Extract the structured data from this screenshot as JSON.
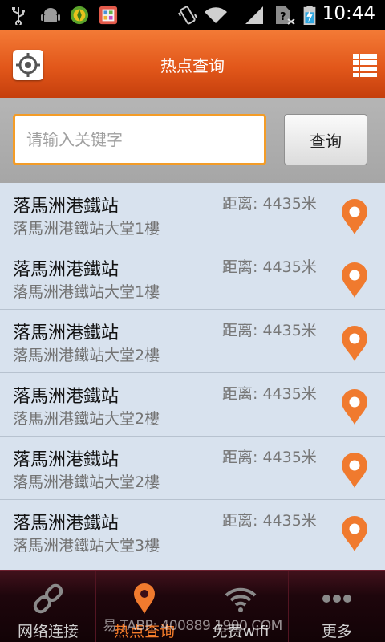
{
  "status_bar": {
    "time": "10:44",
    "icons": [
      "usb-icon",
      "android-debug-icon",
      "app-notification-icon",
      "gallery-notification-icon",
      "vibrate-icon",
      "wifi-icon",
      "signal-icon",
      "no-sim-icon",
      "battery-charging-icon"
    ]
  },
  "header": {
    "title": "热点查询",
    "left_button_icon": "locate-icon",
    "right_button_icon": "list-icon"
  },
  "search": {
    "placeholder": "请输入关键字",
    "value": "",
    "button_label": "查询"
  },
  "colors": {
    "accent": "#f37a36",
    "pin": "#f07a2e",
    "list_bg": "#d8e2ee",
    "nav_bg": "#1e060c"
  },
  "results": [
    {
      "name": "落馬洲港鐵站",
      "address": "落馬洲港鐵站大堂1樓",
      "distance": "距离: 4435米"
    },
    {
      "name": "落馬洲港鐵站",
      "address": "落馬洲港鐵站大堂1樓",
      "distance": "距离: 4435米"
    },
    {
      "name": "落馬洲港鐵站",
      "address": "落馬洲港鐵站大堂2樓",
      "distance": "距离: 4435米"
    },
    {
      "name": "落馬洲港鐵站",
      "address": "落馬洲港鐵站大堂2樓",
      "distance": "距离: 4435米"
    },
    {
      "name": "落馬洲港鐵站",
      "address": "落馬洲港鐵站大堂2樓",
      "distance": "距离: 4435米"
    },
    {
      "name": "落馬洲港鐵站",
      "address": "落馬洲港鐵站大堂3樓",
      "distance": "距离: 4435米"
    },
    {
      "name": "",
      "address": "",
      "distance": ""
    }
  ],
  "bottom_nav": {
    "tabs": [
      {
        "label": "网络连接",
        "icon": "link-icon",
        "active": false
      },
      {
        "label": "热点查询",
        "icon": "location-pin-icon",
        "active": true
      },
      {
        "label": "免费wifi",
        "icon": "wifi-icon",
        "active": false
      },
      {
        "label": "更多",
        "icon": "more-icon",
        "active": false
      }
    ],
    "watermark": "易 TABP: 400889 1900.COM"
  }
}
